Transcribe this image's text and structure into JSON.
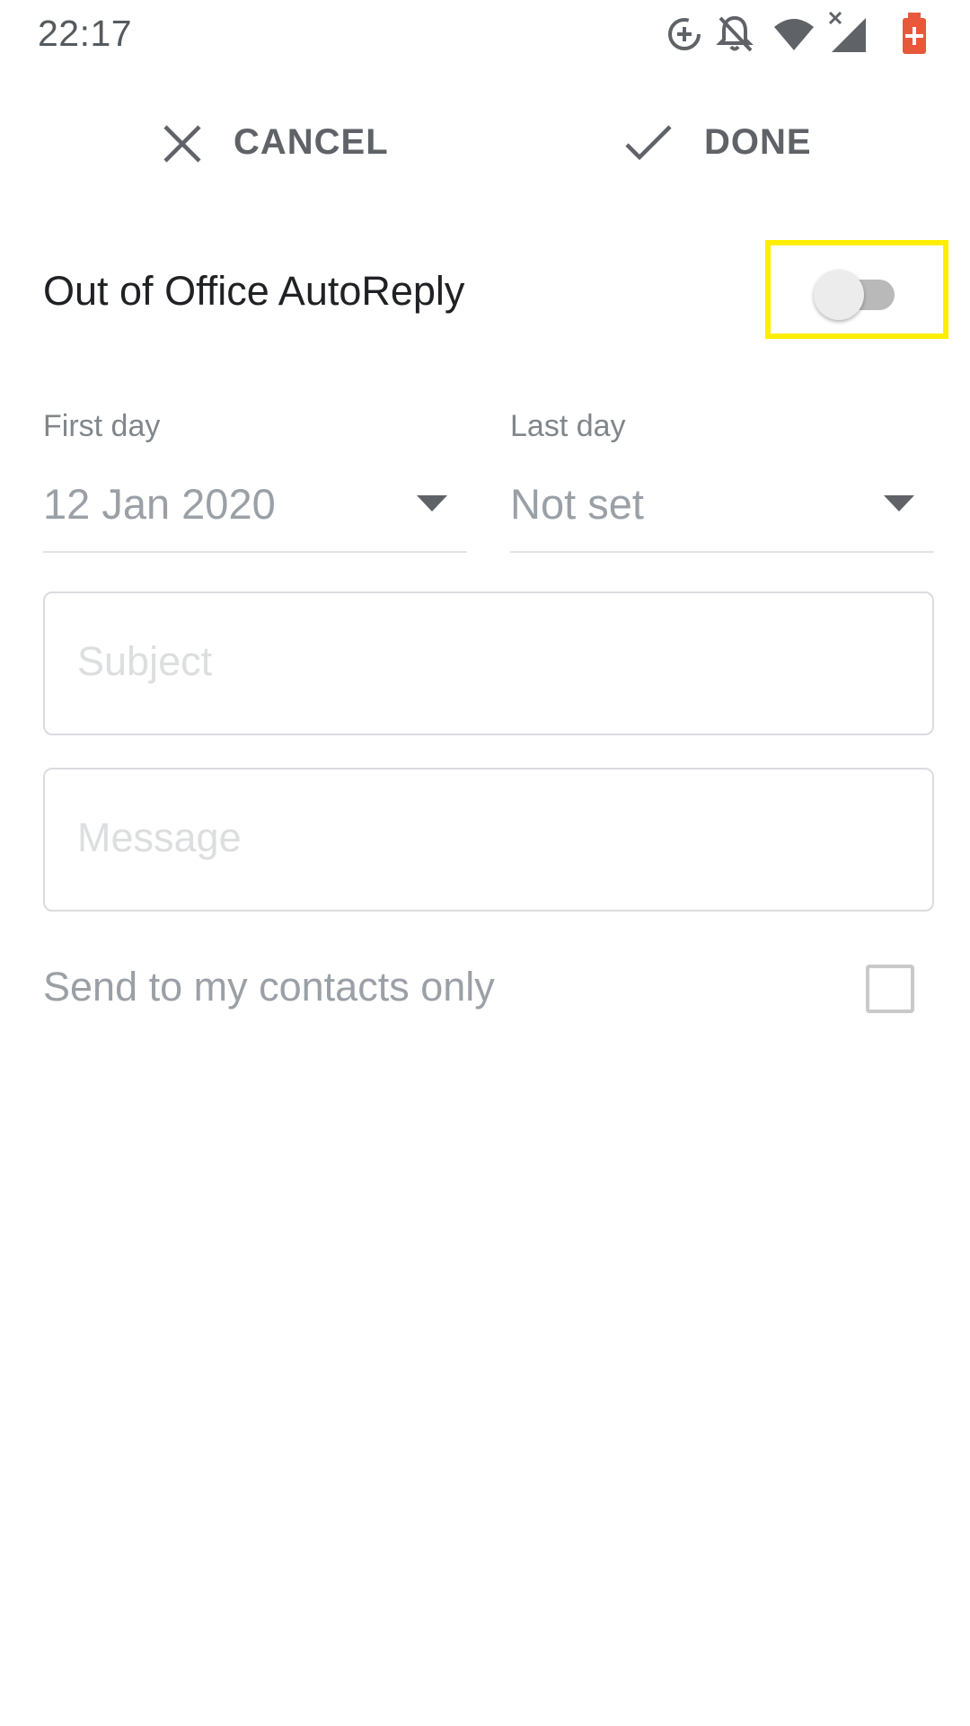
{
  "status_bar": {
    "time": "22:17",
    "icons": [
      "data-saver-icon",
      "notifications-off-icon",
      "wifi-icon",
      "cell-signal-no-data-icon",
      "battery-charging-icon"
    ],
    "battery_color": "#e8583b"
  },
  "action_bar": {
    "cancel_label": "CANCEL",
    "done_label": "DONE"
  },
  "auto_reply": {
    "title": "Out of Office AutoReply",
    "enabled": false
  },
  "first_day": {
    "label": "First day",
    "value": "12 Jan 2020"
  },
  "last_day": {
    "label": "Last day",
    "value": "Not set"
  },
  "subject": {
    "placeholder": "Subject",
    "value": ""
  },
  "message": {
    "placeholder": "Message",
    "value": ""
  },
  "contacts_only": {
    "label": "Send to my contacts only",
    "checked": false
  },
  "colors": {
    "highlight": "#ffee00",
    "text_primary": "#202124",
    "text_secondary": "#9aa0a6"
  }
}
